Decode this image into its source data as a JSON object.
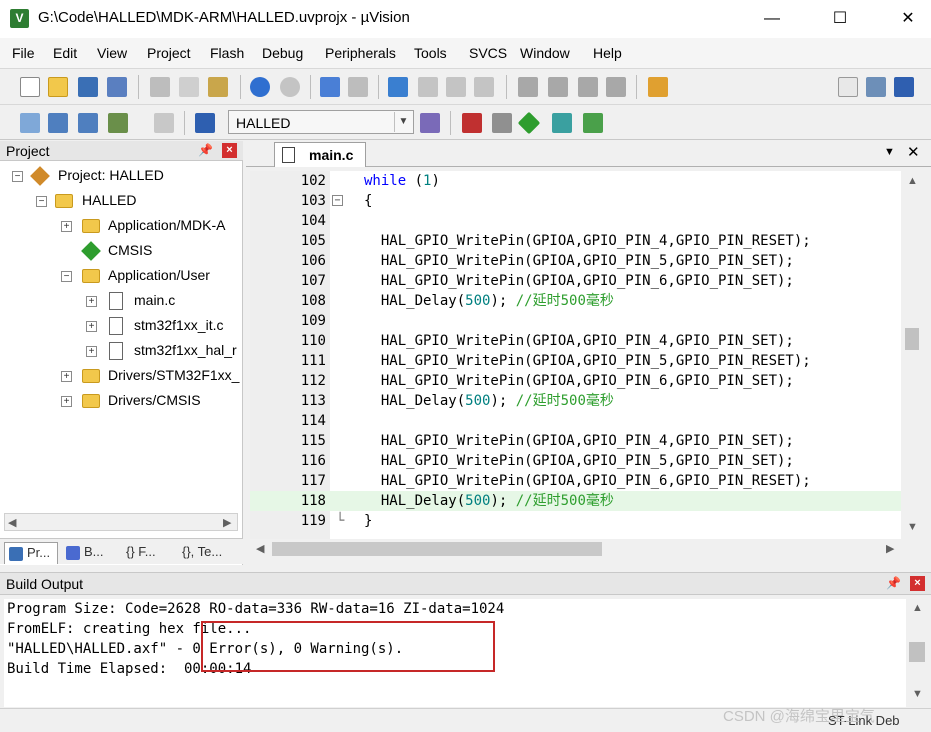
{
  "window": {
    "title": "G:\\Code\\HALLED\\MDK-ARM\\HALLED.uvprojx - µVision",
    "app_icon": "V",
    "minimize": "—",
    "maximize": "☐",
    "close": "✕"
  },
  "menu": [
    "File",
    "Edit",
    "View",
    "Project",
    "Flash",
    "Debug",
    "Peripherals",
    "Tools",
    "SVCS",
    "Window",
    "Help"
  ],
  "toolbar": {
    "target": "HALLED"
  },
  "project_panel": {
    "title": "Project",
    "tree": [
      {
        "label": "Project: HALLED",
        "expander": "−"
      },
      {
        "label": "HALLED",
        "expander": "−"
      },
      {
        "label": "Application/MDK-A",
        "expander": "+"
      },
      {
        "label": "CMSIS",
        "expander": ""
      },
      {
        "label": "Application/User",
        "expander": "−"
      },
      {
        "label": "main.c",
        "expander": "+"
      },
      {
        "label": "stm32f1xx_it.c",
        "expander": "+"
      },
      {
        "label": "stm32f1xx_hal_r",
        "expander": "+"
      },
      {
        "label": "Drivers/STM32F1xx_",
        "expander": "+"
      },
      {
        "label": "Drivers/CMSIS",
        "expander": "+"
      }
    ],
    "tabs": [
      {
        "label": "Pr..."
      },
      {
        "label": "B..."
      },
      {
        "label": "{} F..."
      },
      {
        "label": "{}, Te..."
      }
    ]
  },
  "editor": {
    "tab_label": "main.c",
    "lines": [
      {
        "num": "102",
        "fold": "",
        "code": "while (1)",
        "highlight": false
      },
      {
        "num": "103",
        "fold": "−",
        "code": "{",
        "highlight": false
      },
      {
        "num": "104",
        "fold": "",
        "code": "",
        "highlight": false
      },
      {
        "num": "105",
        "fold": "",
        "code": "  HAL_GPIO_WritePin(GPIOA,GPIO_PIN_4,GPIO_PIN_RESET);",
        "highlight": false
      },
      {
        "num": "106",
        "fold": "",
        "code": "  HAL_GPIO_WritePin(GPIOA,GPIO_PIN_5,GPIO_PIN_SET);",
        "highlight": false
      },
      {
        "num": "107",
        "fold": "",
        "code": "  HAL_GPIO_WritePin(GPIOA,GPIO_PIN_6,GPIO_PIN_SET);",
        "highlight": false
      },
      {
        "num": "108",
        "fold": "",
        "code": "  HAL_Delay(500); //延时500毫秒",
        "highlight": false
      },
      {
        "num": "109",
        "fold": "",
        "code": "",
        "highlight": false
      },
      {
        "num": "110",
        "fold": "",
        "code": "  HAL_GPIO_WritePin(GPIOA,GPIO_PIN_4,GPIO_PIN_SET);",
        "highlight": false
      },
      {
        "num": "111",
        "fold": "",
        "code": "  HAL_GPIO_WritePin(GPIOA,GPIO_PIN_5,GPIO_PIN_RESET);",
        "highlight": false
      },
      {
        "num": "112",
        "fold": "",
        "code": "  HAL_GPIO_WritePin(GPIOA,GPIO_PIN_6,GPIO_PIN_SET);",
        "highlight": false
      },
      {
        "num": "113",
        "fold": "",
        "code": "  HAL_Delay(500); //延时500毫秒",
        "highlight": false
      },
      {
        "num": "114",
        "fold": "",
        "code": "",
        "highlight": false
      },
      {
        "num": "115",
        "fold": "",
        "code": "  HAL_GPIO_WritePin(GPIOA,GPIO_PIN_4,GPIO_PIN_SET);",
        "highlight": false
      },
      {
        "num": "116",
        "fold": "",
        "code": "  HAL_GPIO_WritePin(GPIOA,GPIO_PIN_5,GPIO_PIN_SET);",
        "highlight": false
      },
      {
        "num": "117",
        "fold": "",
        "code": "  HAL_GPIO_WritePin(GPIOA,GPIO_PIN_6,GPIO_PIN_RESET);",
        "highlight": false
      },
      {
        "num": "118",
        "fold": "",
        "code": "  HAL_Delay(500); //延时500毫秒",
        "highlight": true
      },
      {
        "num": "119",
        "fold": "end",
        "code": "}",
        "highlight": false
      }
    ]
  },
  "build_output": {
    "title": "Build Output",
    "lines": [
      "Program Size: Code=2628 RO-data=336 RW-data=16 ZI-data=1024",
      "FromELF: creating hex file...",
      "\"HALLED\\HALLED.axf\" - 0 Error(s), 0 Warning(s).",
      "Build Time Elapsed:  00:00:14"
    ]
  },
  "status": {
    "debugger": "ST-Link Deb"
  },
  "watermark": "CSDN @海绵宝里宝气",
  "colors": {
    "keyword": "#0000ff",
    "number": "#008080",
    "comment": "#2e9e2e",
    "current_line": "#e6f7e6",
    "annotation_box": "#c62828"
  }
}
